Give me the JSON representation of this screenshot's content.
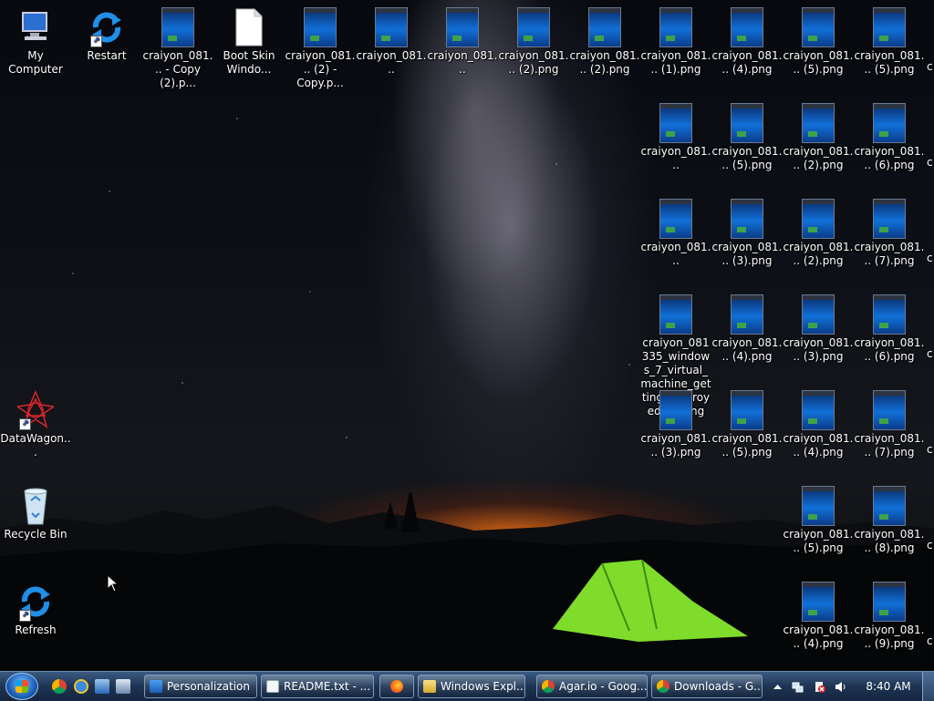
{
  "desktop": {
    "icons": [
      {
        "label": "My Computer"
      },
      {
        "label": "Restart"
      },
      {
        "label": "craiyon_081... - Copy (2).p..."
      },
      {
        "label": "Boot Skin Windo..."
      },
      {
        "label": "craiyon_081... (2) - Copy.p..."
      },
      {
        "label": "craiyon_081..."
      },
      {
        "label": "craiyon_081..."
      },
      {
        "label": "craiyon_081... (2).png"
      },
      {
        "label": "craiyon_081... (2).png"
      },
      {
        "label": "craiyon_081... (1).png"
      },
      {
        "label": "craiyon_081... (4).png"
      },
      {
        "label": "craiyon_081... (5).png"
      },
      {
        "label": "craiyon_081... (5).png"
      },
      {
        "label": "craiyon_081..."
      },
      {
        "label": "craiyon_081... (5).png"
      },
      {
        "label": "craiyon_081... (2).png"
      },
      {
        "label": "craiyon_081... (6).png"
      },
      {
        "label": "craiyon_081..."
      },
      {
        "label": "craiyon_081... (3).png"
      },
      {
        "label": "craiyon_081... (2).png"
      },
      {
        "label": "craiyon_081... (7).png"
      },
      {
        "label": "craiyon_081335_windows_7_virtual_machine_getting_destroyed (2).png"
      },
      {
        "label": "craiyon_081... (4).png"
      },
      {
        "label": "craiyon_081... (3).png"
      },
      {
        "label": "craiyon_081... (6).png"
      },
      {
        "label": "DataWagon..."
      },
      {
        "label": "craiyon_081... (3).png"
      },
      {
        "label": "craiyon_081... (5).png"
      },
      {
        "label": "craiyon_081... (4).png"
      },
      {
        "label": "craiyon_081... (7).png"
      },
      {
        "label": "Recycle Bin"
      },
      {
        "label": "craiyon_081... (5).png"
      },
      {
        "label": "craiyon_081... (8).png"
      },
      {
        "label": "Refresh"
      },
      {
        "label": "craiyon_081... (4).png"
      },
      {
        "label": "craiyon_081... (9).png"
      }
    ],
    "edge_labels": [
      "c",
      "c",
      "c",
      "c",
      "c",
      "c",
      "c"
    ]
  },
  "taskbar": {
    "buttons": [
      {
        "label": "Personalization"
      },
      {
        "label": "README.txt - ..."
      },
      {
        "label": "Windows Expl..."
      },
      {
        "label": "Agar.io - Goog..."
      },
      {
        "label": "Downloads - G..."
      }
    ],
    "clock": "8:40 AM"
  },
  "colors": {
    "taskbar": "#1e3452",
    "accent": "#1170d8",
    "tent": "#7fdc2a",
    "horizon_glow": "#f06e14"
  }
}
